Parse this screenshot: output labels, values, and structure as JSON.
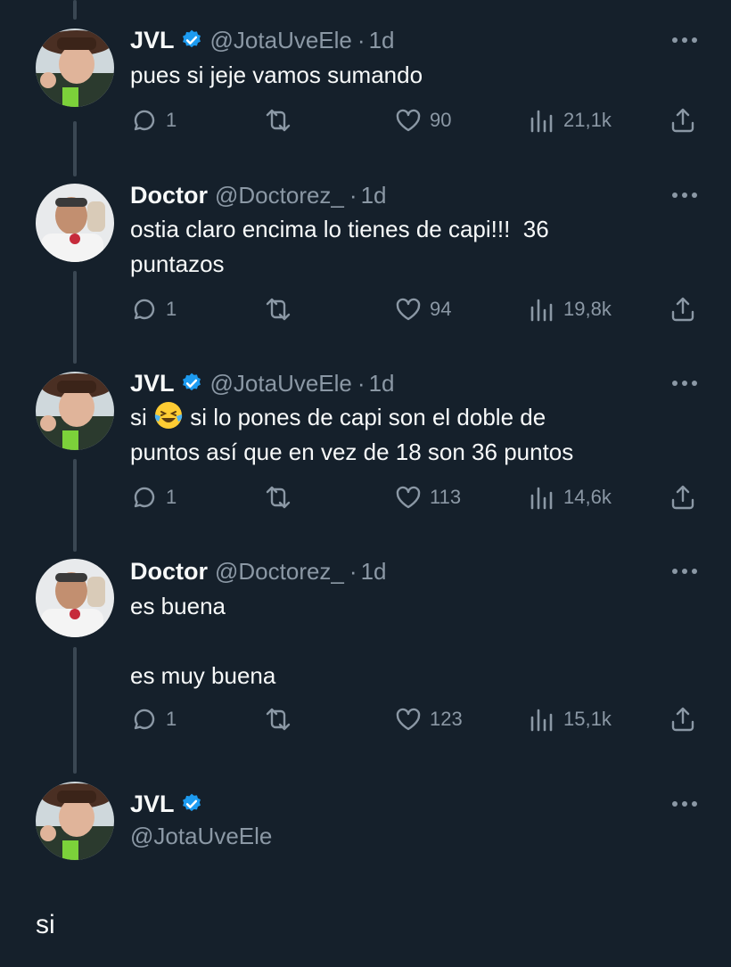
{
  "tweets": [
    {
      "name": "JVL",
      "verified": true,
      "handle": "@JotaUveEle",
      "dot": "·",
      "time": "1d",
      "text": "pues si jeje vamos sumando",
      "replies": "1",
      "likes": "90",
      "views": "21,1k"
    },
    {
      "name": "Doctor",
      "verified": false,
      "handle": "@Doctorez_",
      "dot": "·",
      "time": "1d",
      "text": "ostia claro encima lo tienes de capi!!!  36\npuntazos",
      "replies": "1",
      "likes": "94",
      "views": "19,8k"
    },
    {
      "name": "JVL",
      "verified": true,
      "handle": "@JotaUveEle",
      "dot": "·",
      "time": "1d",
      "text_before": "si ",
      "emoji": "laughing-crying-emoji",
      "text_after": " si lo pones de capi son el doble de\npuntos así que en vez de 18 son 36 puntos",
      "replies": "1",
      "likes": "113",
      "views": "14,6k"
    },
    {
      "name": "Doctor",
      "verified": false,
      "handle": "@Doctorez_",
      "dot": "·",
      "time": "1d",
      "text": "es buena\n\nes muy buena",
      "replies": "1",
      "likes": "123",
      "views": "15,1k"
    }
  ],
  "main_tweet": {
    "name": "JVL",
    "verified": true,
    "handle": "@JotaUveEle",
    "text": "si"
  },
  "colors": {
    "background": "#15202b",
    "muted": "#8b98a5",
    "verified": "#1d9bf0",
    "thread_line": "#3a4753"
  },
  "icons": {
    "reply": "reply-icon",
    "retweet": "retweet-icon",
    "like": "heart-icon",
    "views": "views-icon",
    "share": "share-icon",
    "more": "more-icon",
    "verified": "verified-badge-icon"
  }
}
